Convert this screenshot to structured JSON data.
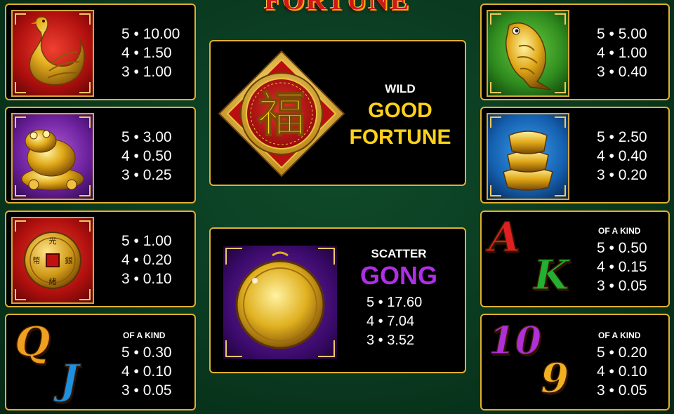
{
  "game": {
    "title": "FORTUNE"
  },
  "left_cards": [
    {
      "symbol": "golden-phoenix",
      "pays": [
        "5 • 10.00",
        "4 • 1.50",
        "3 • 1.00"
      ]
    },
    {
      "symbol": "golden-toad",
      "pays": [
        "5 • 3.00",
        "4 • 0.50",
        "3 • 0.25"
      ]
    },
    {
      "symbol": "gold-coin",
      "pays": [
        "5 • 1.00",
        "4 • 0.20",
        "3 • 0.10"
      ]
    },
    {
      "symbols": [
        "Q",
        "J"
      ],
      "of_a_kind": "OF A KIND",
      "pays": [
        "5 • 0.30",
        "4 • 0.10",
        "3 • 0.05"
      ]
    }
  ],
  "right_cards": [
    {
      "symbol": "golden-koi",
      "pays": [
        "5 • 5.00",
        "4 • 1.00",
        "3 • 0.40"
      ]
    },
    {
      "symbol": "gold-ingot",
      "pays": [
        "5 • 2.50",
        "4 • 0.40",
        "3 • 0.20"
      ]
    },
    {
      "symbols": [
        "A",
        "K"
      ],
      "of_a_kind": "OF A KIND",
      "pays": [
        "5 • 0.50",
        "4 • 0.15",
        "3 • 0.05"
      ]
    },
    {
      "symbols": [
        "10",
        "9"
      ],
      "of_a_kind": "OF A KIND",
      "pays": [
        "5 • 0.20",
        "4 • 0.10",
        "3 • 0.05"
      ]
    }
  ],
  "wild": {
    "label": "WILD",
    "name_line1": "GOOD",
    "name_line2": "FORTUNE",
    "glyph": "福"
  },
  "scatter": {
    "label": "SCATTER",
    "name": "GONG",
    "pays": [
      "5 • 17.60",
      "4 • 7.04",
      "3 • 3.52"
    ]
  },
  "colors": {
    "card_border": "#e0b030",
    "wild_text": "#ffd21a",
    "scatter_text": "#b02ee8",
    "letter_Q": "#f0a020",
    "letter_J": "#1e90e0",
    "letter_A": "#e02020",
    "letter_K": "#22b030",
    "letter_10": "#b030d8",
    "letter_9": "#f0b020"
  }
}
